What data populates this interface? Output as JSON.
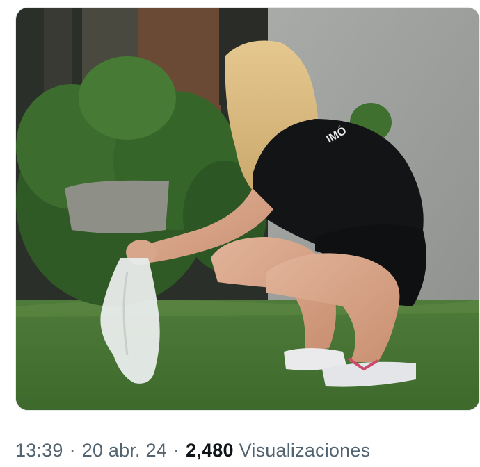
{
  "post": {
    "media": {
      "kind": "photo"
    },
    "meta": {
      "time": "13:39",
      "separator": "·",
      "date": "20 abr. 24",
      "views_count": "2,480",
      "views_label": "Visualizaciones"
    }
  },
  "colors": {
    "meta_text": "#536471",
    "count_text": "#0f1419",
    "frame_border": "#e6e9ec"
  }
}
